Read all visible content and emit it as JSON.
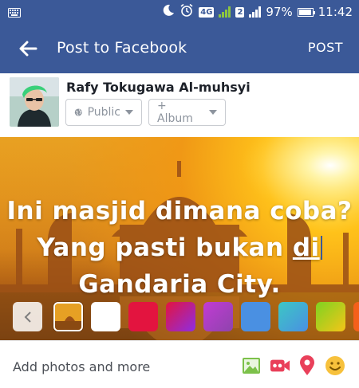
{
  "status_bar": {
    "network": "4G",
    "sim_badge": "2",
    "battery_percent": "97%",
    "battery_level": 0.97,
    "time": "11:42",
    "icons": [
      "keyboard-icon",
      "moon-icon",
      "alarm-icon",
      "signal-icon",
      "battery-icon"
    ]
  },
  "app_bar": {
    "title": "Post to Facebook",
    "post_label": "POST",
    "color": "#3b5998"
  },
  "composer": {
    "user_name": "Rafy Tokugawa Al-muhsyi",
    "audience_label": "Public",
    "album_label": "+ Album"
  },
  "post": {
    "line1": "Ini masjid dimana coba?",
    "line2_prefix": "Yang pasti bukan ",
    "line2_underlined": "di",
    "line3": "Gandaria City."
  },
  "backgrounds": {
    "colors": [
      "#ffffff",
      "#e3143f",
      "#8e2de2",
      "#c23bd4",
      "#4a90e2",
      "#3cc7c4",
      "#7ed321",
      "#f5601a"
    ]
  },
  "bottom_bar": {
    "add_label": "Add photos and more",
    "tool_icons": [
      "photo-icon",
      "video-icon",
      "location-pin-icon",
      "emoji-icon"
    ]
  }
}
